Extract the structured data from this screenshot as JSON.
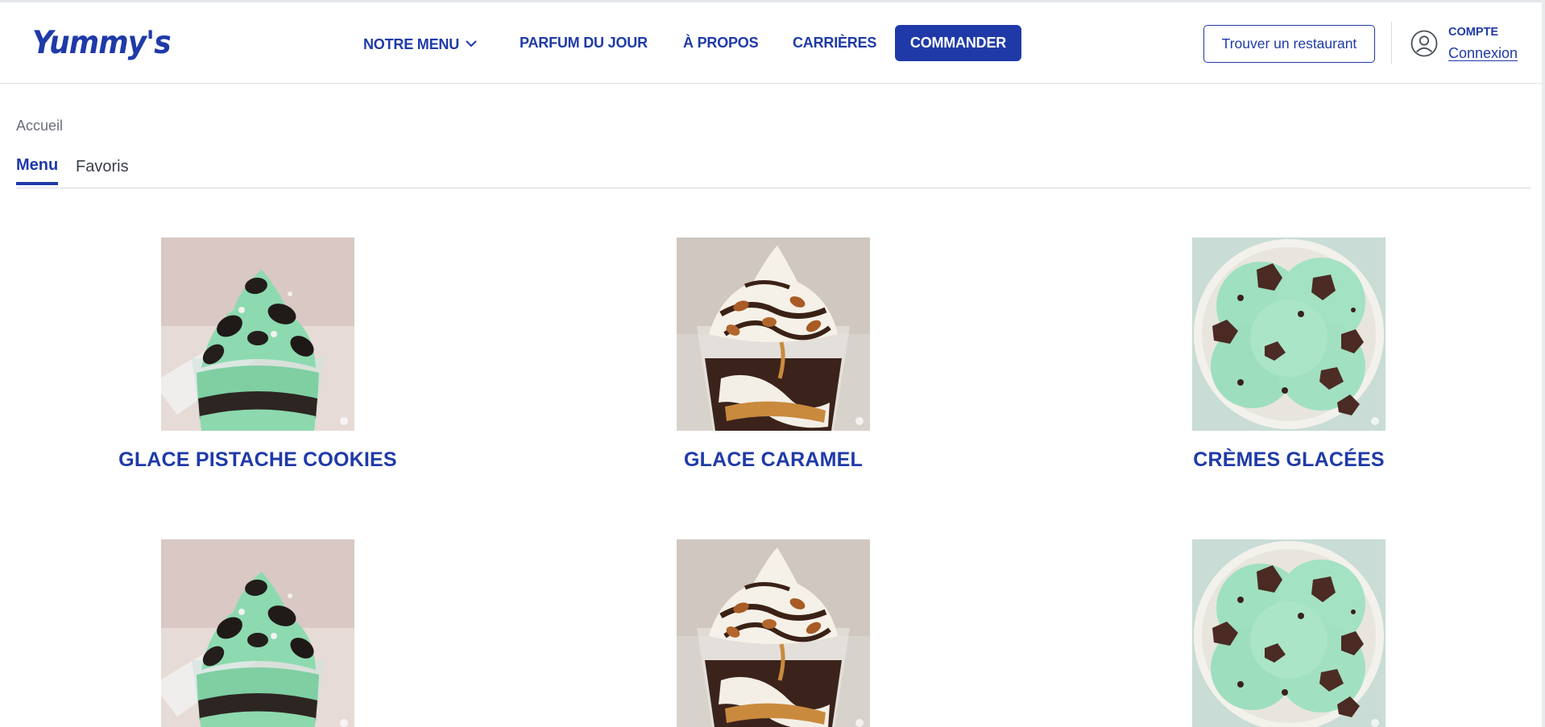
{
  "header": {
    "logo": "Yummy's",
    "nav": {
      "menu": "NOTRE MENU",
      "parfum": "PARFUM DU JOUR",
      "apropos": "À PROPOS",
      "carrieres": "CARRIÈRES",
      "order": "COMMANDER"
    },
    "find_restaurant": "Trouver un restaurant",
    "account": {
      "title": "COMPTE",
      "link": "Connexion"
    }
  },
  "breadcrumb": "Accueil",
  "tabs": [
    {
      "label": "Menu",
      "active": true
    },
    {
      "label": "Favoris",
      "active": false
    }
  ],
  "products": [
    {
      "name": "GLACE PISTACHE COOKIES",
      "image": "mint-cookie-sundae-image"
    },
    {
      "name": "GLACE CARAMEL",
      "image": "caramel-sundae-image"
    },
    {
      "name": "CRÈMES GLACÉES",
      "image": "mint-ice-cream-bowl-image"
    },
    {
      "name": "",
      "image": "mint-cookie-sundae-image"
    },
    {
      "name": "",
      "image": "caramel-sundae-image"
    },
    {
      "name": "",
      "image": "mint-ice-cream-bowl-image"
    }
  ],
  "colors": {
    "brand": "#1f3aa8",
    "muted": "#6b6f7a",
    "border": "#d6d9df"
  }
}
